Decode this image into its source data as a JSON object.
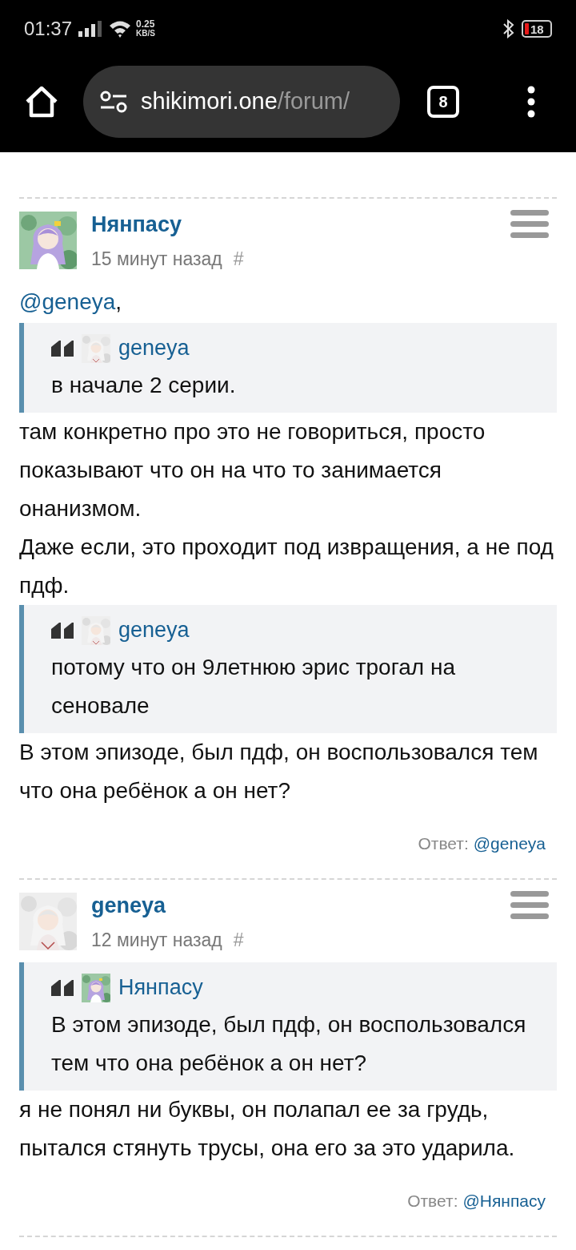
{
  "status_bar": {
    "time": "01:37",
    "net_speed": "0.25",
    "net_unit": "KB/S",
    "battery": "18"
  },
  "browser": {
    "domain": "shikimori.one",
    "path": "/forum/",
    "tab_count": "8"
  },
  "posts": [
    {
      "author": "Нянпасу",
      "time": "15 минут назад",
      "hash": "#",
      "blocks": [
        {
          "kind": "mention",
          "handle": "@geneya",
          "suffix": ","
        },
        {
          "kind": "quote",
          "author": "geneya",
          "text": "в начале 2 серии."
        },
        {
          "kind": "text",
          "text": "там конкретно про это не говориться, просто показывают что он на что то занимается онанизмом."
        },
        {
          "kind": "text",
          "text": "Даже если, это проходит под извращения, а не под пдф."
        },
        {
          "kind": "quote",
          "author": "geneya",
          "text": "потому что он 9летнюю эрис трогал на сеновале"
        },
        {
          "kind": "text",
          "text": "В этом эпизоде, был пдф, он воспользовался тем что она ребёнок а он нет?"
        }
      ],
      "reply_label": "Ответ:",
      "reply_to": "@geneya"
    },
    {
      "author": "geneya",
      "time": "12 минут назад",
      "hash": "#",
      "blocks": [
        {
          "kind": "quote",
          "author": "Нянпасу",
          "text": "В этом эпизоде, был пдф, он воспользовался тем что она ребёнок а он нет?"
        },
        {
          "kind": "text",
          "text": "я не понял ни буквы, он полапал ее за грудь, пытался стянуть трусы, она его за это ударила."
        }
      ],
      "reply_label": "Ответ:",
      "reply_to": "@Нянпасу"
    }
  ]
}
